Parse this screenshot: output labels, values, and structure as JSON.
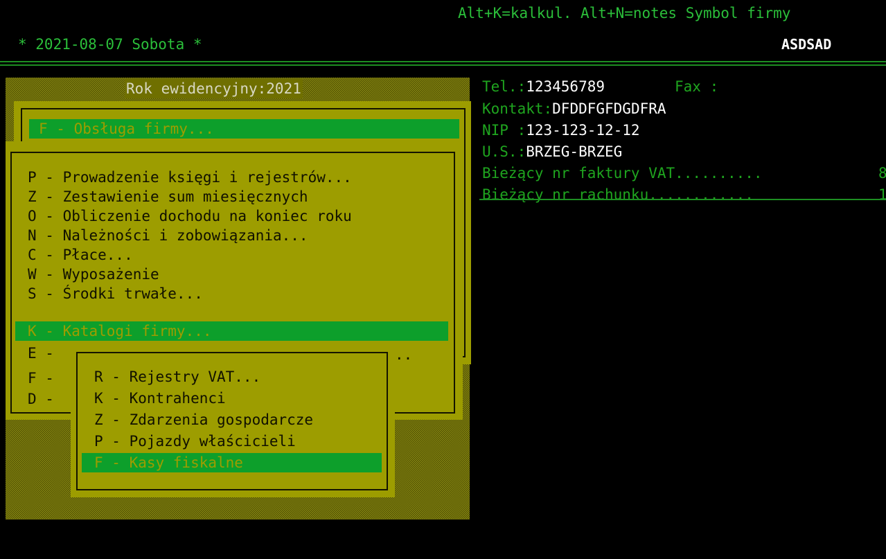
{
  "header": {
    "hint": "Alt+K=kalkul. Alt+N=notes Symbol firmy",
    "date": "* 2021-08-07 Sobota *",
    "company_symbol": "ASDSAD"
  },
  "year_panel": {
    "title": "Rok ewidencyjny:2021"
  },
  "main_menu": {
    "selected": "F - Obsługa firmy..."
  },
  "submenu": {
    "items": [
      "P - Prowadzenie księgi i rejestrów...",
      "Z - Zestawienie sum miesięcznych",
      "O - Obliczenie dochodu na koniec roku",
      "N - Należności i zobowiązania...",
      "C - Płace...",
      "W - Wyposażenie",
      "S - Środki trwałe...",
      "K - Katalogi firmy...",
      "E -",
      "F -",
      "D -"
    ],
    "trailing_dots": ".."
  },
  "catalog_menu": {
    "items": [
      "R - Rejestry VAT...",
      "K - Kontrahenci",
      "Z - Zdarzenia gospodarcze",
      "P - Pojazdy właścicieli",
      "F - Kasy fiskalne"
    ]
  },
  "company_info": {
    "tel_label": "Tel.:",
    "tel": "123456789",
    "fax_label": "Fax :",
    "contact_label": "Kontakt:",
    "contact": "DFDDFGFDGDFRA",
    "nip_label": "NIP :",
    "nip": "123-123-12-12",
    "us_label": "U.S.:",
    "us": "BRZEG-BRZEG",
    "vat_invoice_label": "Bieżący nr faktury VAT..........",
    "vat_invoice_value": "8",
    "bill_label": "Bieżący nr rachunku............",
    "bill_value": "1"
  },
  "colors": {
    "terminal_green": "#1fa51f",
    "menu_yellow": "#9d9d00",
    "selection_green": "#0d9f2b"
  }
}
